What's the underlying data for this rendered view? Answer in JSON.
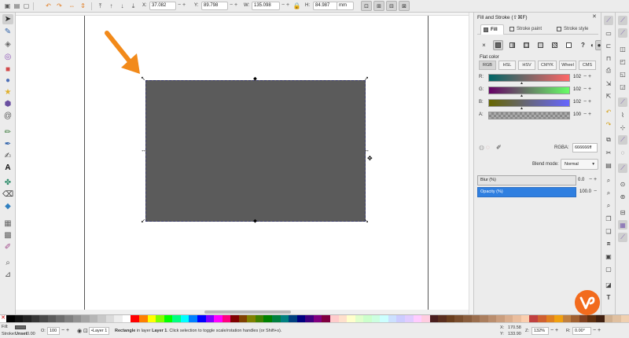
{
  "toolbar": {
    "x_label": "X:",
    "x_value": "37.082",
    "y_label": "Y:",
    "y_value": "89.798",
    "w_label": "W:",
    "w_value": "135.098",
    "h_label": "H:",
    "h_value": "84.987",
    "unit": "mm"
  },
  "panel": {
    "title": "Fill and Stroke (⇧⌘F)",
    "tabs": [
      {
        "label": "Fill"
      },
      {
        "label": "Stroke paint"
      },
      {
        "label": "Stroke style"
      }
    ],
    "paint_unset_glyph": "×",
    "paint_unknown_glyph": "?",
    "flat_color_label": "Flat color",
    "modes": [
      "RGB",
      "HSL",
      "HSV",
      "CMYK",
      "Wheel",
      "CMS"
    ],
    "channels": [
      {
        "label": "R:",
        "value": "102"
      },
      {
        "label": "G:",
        "value": "102"
      },
      {
        "label": "B:",
        "value": "102"
      },
      {
        "label": "A:",
        "value": "100"
      }
    ],
    "rgba_label": "RGBA:",
    "rgba_value": "666666ff",
    "blend_label": "Blend mode:",
    "blend_value": "Normal",
    "blur_label": "Blur (%)",
    "blur_value": "0.0",
    "opacity_label": "Opacity (%)",
    "opacity_value": "100.0"
  },
  "status": {
    "fill_label": "Fill:",
    "stroke_label": "Stroke:",
    "stroke_value": "Unset",
    "stroke_width": "0.00",
    "opacity_label": "O:",
    "opacity_value": "100",
    "layer_value": "•Layer 1",
    "message_bold": "Rectangle",
    "message_mid": " in layer ",
    "message_layer": "Layer 1",
    "message_rest": ". Click selection to toggle scale/rotation handles (or Shift+s).",
    "x_label": "X:",
    "x_value": "170.58",
    "y_label": "Y:",
    "y_value": "133.90",
    "zoom_label": "Z:",
    "zoom_value": "132%",
    "rotation_label": "R:",
    "rotation_value": "0.00°"
  },
  "colors": {
    "rect_fill": "#5b5b5b",
    "arrow": "#f28a1a",
    "accent_blue": "#2f7fe0",
    "logo": "#f26b1d"
  },
  "icons": {
    "handle_corner": "↖",
    "handle_side": "↔"
  }
}
